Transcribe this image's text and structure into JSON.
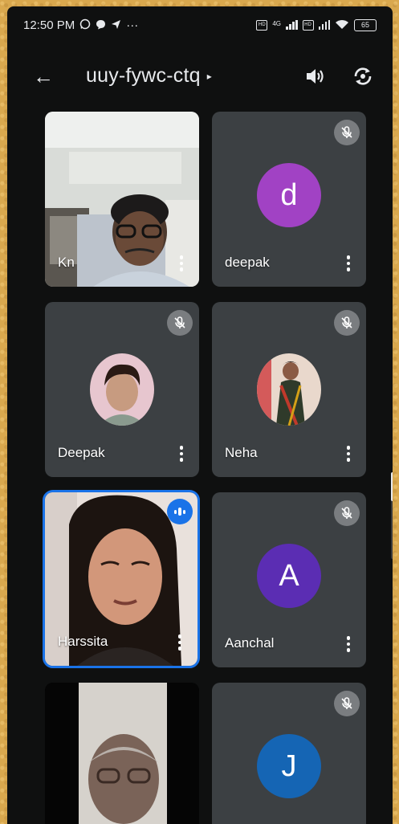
{
  "status_bar": {
    "time": "12:50 PM",
    "more": "···",
    "network_label": "4G",
    "sim_label": "HD",
    "battery": "65"
  },
  "app_bar": {
    "meeting_code": "uuy-fywc-ctq",
    "title_caret": "▸",
    "back_glyph": "←"
  },
  "participants": [
    {
      "name": "Kn",
      "type": "video",
      "muted": false
    },
    {
      "name": "deepak",
      "type": "avatar",
      "initial": "d",
      "avatar_color": "#a142c4",
      "muted": true
    },
    {
      "name": "Deepak",
      "type": "photo",
      "muted": true
    },
    {
      "name": "Neha",
      "type": "photo",
      "muted": true
    },
    {
      "name": "Harssita",
      "type": "video",
      "muted": false,
      "speaking": true
    },
    {
      "name": "Aanchal",
      "type": "avatar",
      "initial": "A",
      "avatar_color": "#5b2db3",
      "muted": true
    },
    {
      "name": "",
      "type": "video",
      "muted": false
    },
    {
      "name": "",
      "type": "avatar",
      "initial": "J",
      "avatar_color": "#1565b4",
      "muted": true
    }
  ],
  "colors": {
    "background": "#0f1010",
    "tile": "#3c4043",
    "speaking_outline": "#1a73e8",
    "mute_badge": "#7a7d80"
  },
  "icons": [
    "whatsapp-icon",
    "chat-icon",
    "send-icon",
    "back-arrow-icon",
    "speaker-icon",
    "switch-camera-icon",
    "mic-off-icon",
    "more-vert-icon",
    "audio-level-icon",
    "wifi-icon",
    "signal-icon",
    "battery-icon"
  ]
}
